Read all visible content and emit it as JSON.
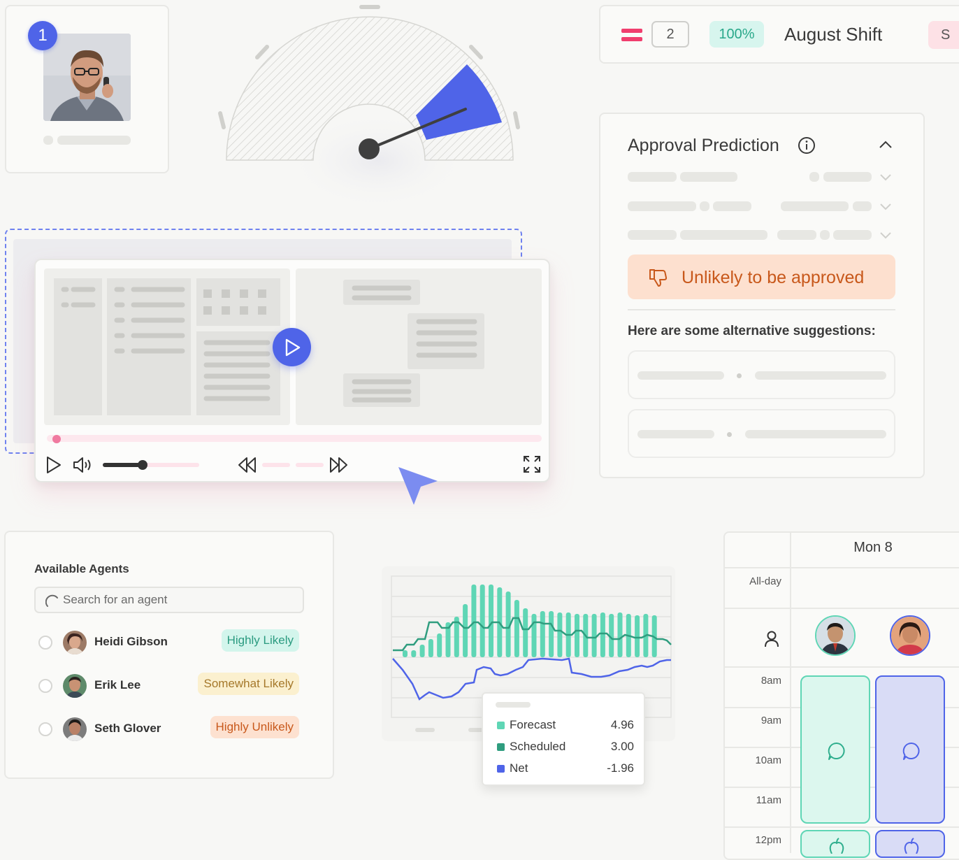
{
  "profile": {
    "badge_number": "1"
  },
  "shift_header": {
    "count": "2",
    "percent": "100%",
    "name": "August Shift",
    "next_tab": "S"
  },
  "approval": {
    "title": "Approval Prediction",
    "status": "Unlikely to be approved",
    "alternatives_label": "Here are some alternative suggestions:"
  },
  "agents": {
    "title": "Available Agents",
    "search_placeholder": "Search for an agent",
    "list": [
      {
        "name": "Heidi Gibson",
        "likelihood": "Highly Likely",
        "tone": "green"
      },
      {
        "name": "Erik Lee",
        "likelihood": "Somewhat Likely",
        "tone": "yellow"
      },
      {
        "name": "Seth Glover",
        "likelihood": "Highly Unlikely",
        "tone": "orange"
      }
    ]
  },
  "chart_tooltip": {
    "rows": [
      {
        "name": "Forecast",
        "value": "4.96",
        "color": "#5fd6b5"
      },
      {
        "name": "Scheduled",
        "value": "3.00",
        "color": "#2f9d7f"
      },
      {
        "name": "Net",
        "value": "-1.96",
        "color": "#4f64e8"
      }
    ]
  },
  "calendar": {
    "day": "Mon 8",
    "all_day": "All-day",
    "times": [
      "8am",
      "9am",
      "10am",
      "11am",
      "12pm"
    ]
  },
  "colors": {
    "accent": "#4f64e8",
    "teal": "#5fd6b5",
    "teal_dark": "#2f9d7f",
    "warning": "#c8581b",
    "pink": "#f03e6e"
  }
}
